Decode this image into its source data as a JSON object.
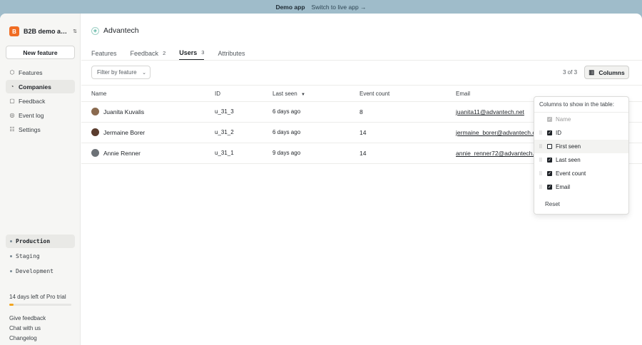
{
  "banner": {
    "title": "Demo app",
    "link": "Switch to live app →"
  },
  "sidebar": {
    "org_logo": "B",
    "org_name": "B2B demo a…",
    "new_feature": "New feature",
    "nav": [
      {
        "label": "Features",
        "icon": "features-icon"
      },
      {
        "label": "Companies",
        "icon": "companies-icon",
        "active": true
      },
      {
        "label": "Feedback",
        "icon": "feedback-icon"
      },
      {
        "label": "Event log",
        "icon": "event-log-icon"
      },
      {
        "label": "Settings",
        "icon": "settings-icon"
      }
    ],
    "environments": [
      "Production",
      "Staging",
      "Development"
    ],
    "trial_text": "14 days left of Pro trial",
    "trial_progress": 0.07,
    "footer": [
      "Give feedback",
      "Chat with us",
      "Changelog"
    ]
  },
  "main": {
    "company": "Advantech",
    "tabs": [
      {
        "label": "Features",
        "count": ""
      },
      {
        "label": "Feedback",
        "count": "2"
      },
      {
        "label": "Users",
        "count": "3",
        "active": true
      },
      {
        "label": "Attributes",
        "count": ""
      }
    ],
    "filter_label": "Filter by feature",
    "count_text": "3 of 3",
    "columns_button": "Columns",
    "columns": {
      "name": "Name",
      "id": "ID",
      "last_seen": "Last seen",
      "event_count": "Event count",
      "email": "Email"
    },
    "rows": [
      {
        "name": "Juanita Kuvalis",
        "id": "u_31_3",
        "last_seen": "6 days ago",
        "event_count": "8",
        "email": "juanita11@advantech.net",
        "avatar_color": "#8a6a4f"
      },
      {
        "name": "Jermaine Borer",
        "id": "u_31_2",
        "last_seen": "6 days ago",
        "event_count": "14",
        "email": "jermaine_borer@advantech.c",
        "avatar_color": "#5a3c2e"
      },
      {
        "name": "Annie Renner",
        "id": "u_31_1",
        "last_seen": "9 days ago",
        "event_count": "14",
        "email": "annie_renner72@advantech.",
        "avatar_color": "#6d7277"
      }
    ]
  },
  "popover": {
    "title": "Columns to show in the table:",
    "options": [
      {
        "label": "Name",
        "checked": true,
        "disabled": true
      },
      {
        "label": "ID",
        "checked": true
      },
      {
        "label": "First seen",
        "checked": false
      },
      {
        "label": "Last seen",
        "checked": true
      },
      {
        "label": "Event count",
        "checked": true
      },
      {
        "label": "Email",
        "checked": true
      }
    ],
    "reset": "Reset"
  }
}
